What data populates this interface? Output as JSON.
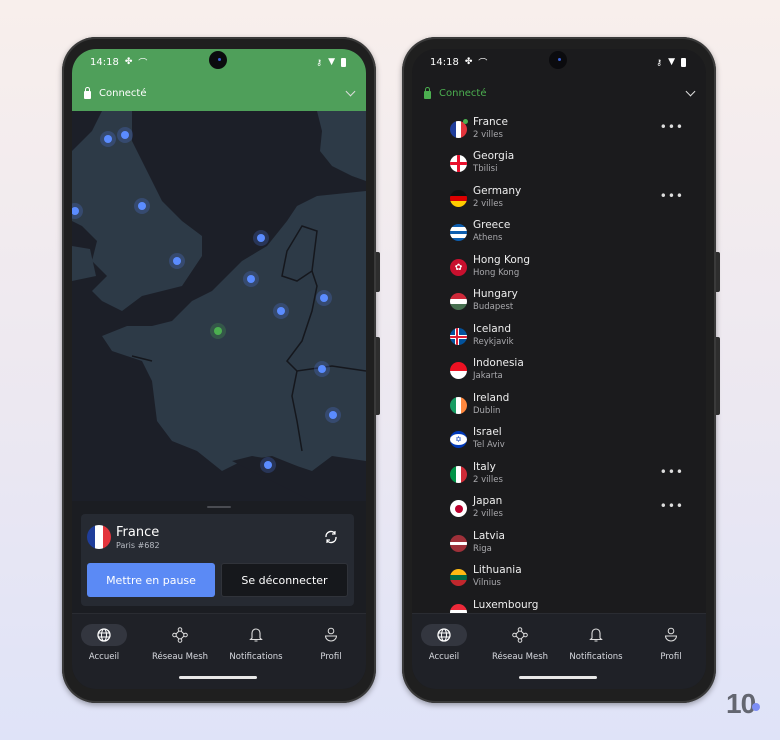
{
  "status": {
    "time": "14:18"
  },
  "connection": {
    "label": "Connecté",
    "green": "#4caf50",
    "bar_color": "#4f9f5a"
  },
  "current": {
    "country": "France",
    "server": "Paris #682"
  },
  "buttons": {
    "pause": "Mettre en pause",
    "disconnect": "Se déconnecter"
  },
  "nav": {
    "items": [
      {
        "label": "Accueil",
        "icon": "globe-icon",
        "active": true
      },
      {
        "label": "Réseau Mesh",
        "icon": "mesh-icon",
        "active": false
      },
      {
        "label": "Notifications",
        "icon": "bell-icon",
        "active": false
      },
      {
        "label": "Profil",
        "icon": "profile-icon",
        "active": false
      }
    ]
  },
  "countries": [
    {
      "name": "France",
      "sub": "2 villes",
      "more": true,
      "online": true
    },
    {
      "name": "Georgia",
      "sub": "Tbilisi",
      "more": false
    },
    {
      "name": "Germany",
      "sub": "2 villes",
      "more": true
    },
    {
      "name": "Greece",
      "sub": "Athens",
      "more": false
    },
    {
      "name": "Hong Kong",
      "sub": "Hong Kong",
      "more": false
    },
    {
      "name": "Hungary",
      "sub": "Budapest",
      "more": false
    },
    {
      "name": "Iceland",
      "sub": "Reykjavik",
      "more": false
    },
    {
      "name": "Indonesia",
      "sub": "Jakarta",
      "more": false
    },
    {
      "name": "Ireland",
      "sub": "Dublin",
      "more": false
    },
    {
      "name": "Israel",
      "sub": "Tel Aviv",
      "more": false
    },
    {
      "name": "Italy",
      "sub": "2 villes",
      "more": true
    },
    {
      "name": "Japan",
      "sub": "2 villes",
      "more": true
    },
    {
      "name": "Latvia",
      "sub": "Riga",
      "more": false
    },
    {
      "name": "Lithuania",
      "sub": "Vilnius",
      "more": false
    },
    {
      "name": "Luxembourg",
      "sub": "",
      "more": false
    }
  ],
  "more_label": "•••",
  "brand": {
    "logo_text": "10",
    "accent": "#7d8ef5"
  }
}
